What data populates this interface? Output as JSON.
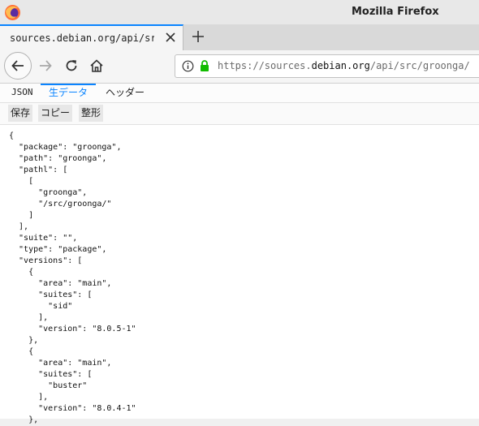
{
  "window": {
    "title": "Mozilla Firefox"
  },
  "tab": {
    "title": "sources.debian.org/api/src/",
    "close_icon": "close-icon"
  },
  "url": {
    "scheme": "https://sources.",
    "domain": "debian.org",
    "path": "/api/src/groonga/"
  },
  "viewer": {
    "tabs": {
      "json": "JSON",
      "raw": "生データ",
      "headers": "ヘッダー"
    },
    "buttons": {
      "save": "保存",
      "copy": "コピー",
      "pretty": "整形"
    },
    "raw_json": "{\n  \"package\": \"groonga\",\n  \"path\": \"groonga\",\n  \"pathl\": [\n    [\n      \"groonga\",\n      \"/src/groonga/\"\n    ]\n  ],\n  \"suite\": \"\",\n  \"type\": \"package\",\n  \"versions\": [\n    {\n      \"area\": \"main\",\n      \"suites\": [\n        \"sid\"\n      ],\n      \"version\": \"8.0.5-1\"\n    },\n    {\n      \"area\": \"main\",\n      \"suites\": [\n        \"buster\"\n      ],\n      \"version\": \"8.0.4-1\"\n    },"
  },
  "colors": {
    "accent": "#0a84ff",
    "lock": "#12bc00"
  }
}
